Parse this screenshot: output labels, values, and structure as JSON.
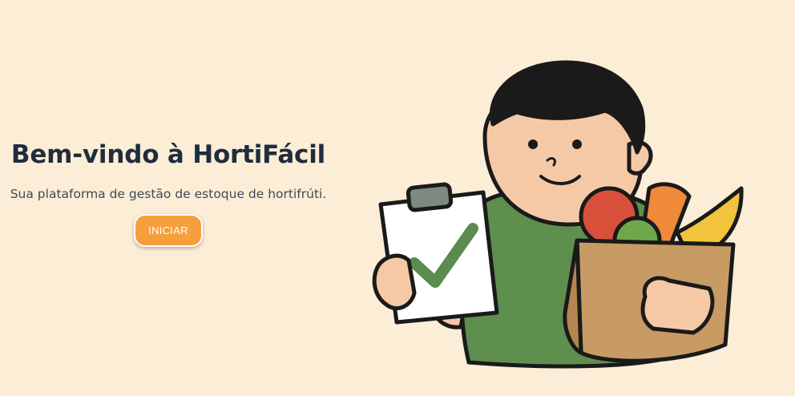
{
  "hero": {
    "title": "Bem-vindo à HortiFácil",
    "subtitle": "Sua plataforma de gestão de estoque de hortifrúti.",
    "start_button_label": "INICIAR"
  },
  "illustration": {
    "subject": "grocer-holding-checklist-and-produce-bag-icon"
  },
  "colors": {
    "background": "#FCEDD6",
    "title": "#1F2D3D",
    "button": "#F6A03D",
    "shirt": "#5E8F4E",
    "check": "#5B8B4E"
  }
}
